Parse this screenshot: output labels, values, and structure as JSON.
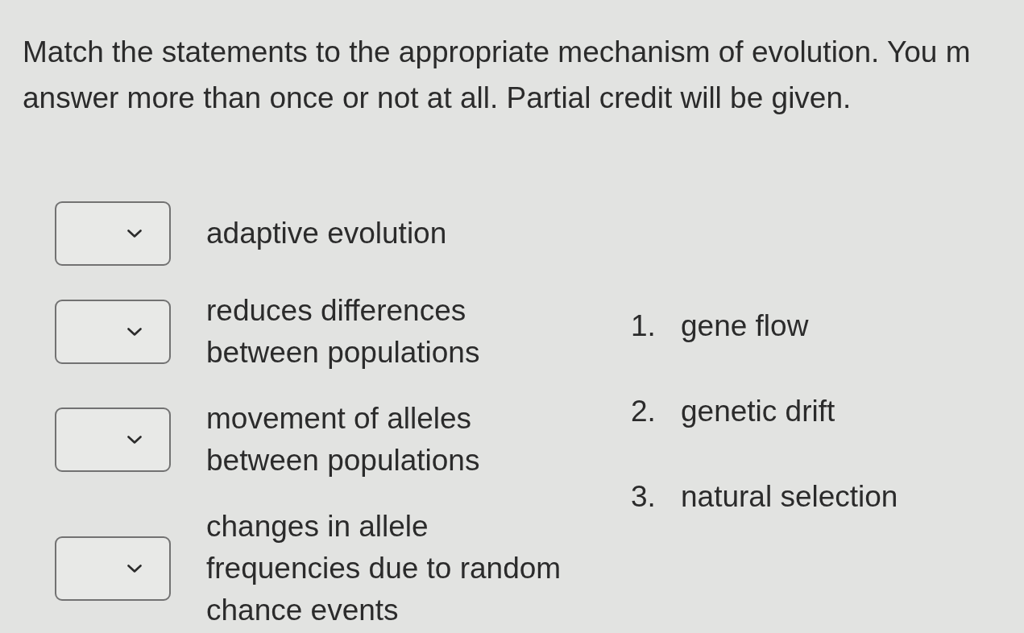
{
  "instructions": {
    "lines": [
      "Match the statements to the appropriate mechanism of evolution. You m",
      "answer more than once or not at all. Partial credit will be given."
    ]
  },
  "statements": [
    {
      "text": "adaptive evolution"
    },
    {
      "text": "reduces differences between populations"
    },
    {
      "text": "movement of alleles between populations"
    },
    {
      "text": "changes in allele frequencies due to random chance events"
    }
  ],
  "options": [
    {
      "number": "1.",
      "label": "gene flow"
    },
    {
      "number": "2.",
      "label": "genetic drift"
    },
    {
      "number": "3.",
      "label": "natural selection"
    }
  ]
}
